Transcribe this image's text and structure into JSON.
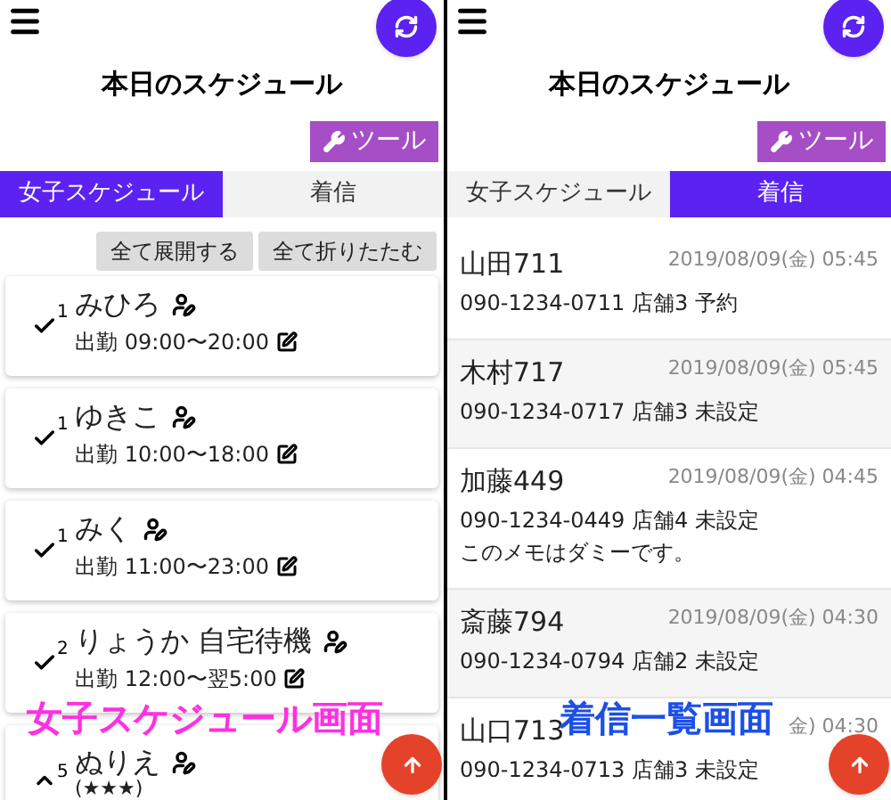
{
  "left_screen": {
    "title": "本日のスケジュール",
    "tool_button": "ツール",
    "tabs": [
      {
        "label": "女子スケジュール",
        "selected": true
      },
      {
        "label": "着信",
        "selected": false
      }
    ],
    "actions": [
      "全て展開する",
      "全て折りたたむ"
    ],
    "cards": [
      {
        "count": "1",
        "name": "みひろ",
        "expanded": false,
        "detail": "出勤 09:00〜20:00",
        "kind": "shift"
      },
      {
        "count": "1",
        "name": "ゆきこ",
        "expanded": false,
        "detail": "出勤 10:00〜18:00",
        "kind": "shift"
      },
      {
        "count": "1",
        "name": "みく",
        "expanded": false,
        "detail": "出勤 11:00〜23:00",
        "kind": "shift"
      },
      {
        "count": "2",
        "name": "りょうか 自宅待機",
        "expanded": false,
        "detail": "出勤 12:00〜翌5:00",
        "kind": "shift"
      },
      {
        "count": "5",
        "name": "ぬりえ",
        "expanded": true,
        "detail": "(★★★)",
        "kind": "rating"
      }
    ],
    "caption": "女子スケジュール画面"
  },
  "right_screen": {
    "title": "本日のスケジュール",
    "tool_button": "ツール",
    "tabs": [
      {
        "label": "女子スケジュール",
        "selected": false
      },
      {
        "label": "着信",
        "selected": true
      }
    ],
    "calls": [
      {
        "name": "山田711",
        "date": "2019/08/09(金) 05:45",
        "line": "090-1234-0711 店舗3 予約"
      },
      {
        "name": "木村717",
        "date": "2019/08/09(金) 05:45",
        "line": "090-1234-0717 店舗3 未設定"
      },
      {
        "name": "加藤449",
        "date": "2019/08/09(金) 04:45",
        "line": "090-1234-0449 店舗4 未設定",
        "memo": "このメモはダミーです。"
      },
      {
        "name": "斎藤794",
        "date": "2019/08/09(金) 04:30",
        "line": "090-1234-0794 店舗2 未設定"
      },
      {
        "name": "山口713",
        "date": "金) 04:30",
        "line": "090-1234-0713 店舗3 未設定"
      }
    ],
    "caption": "着信一覧画面"
  }
}
